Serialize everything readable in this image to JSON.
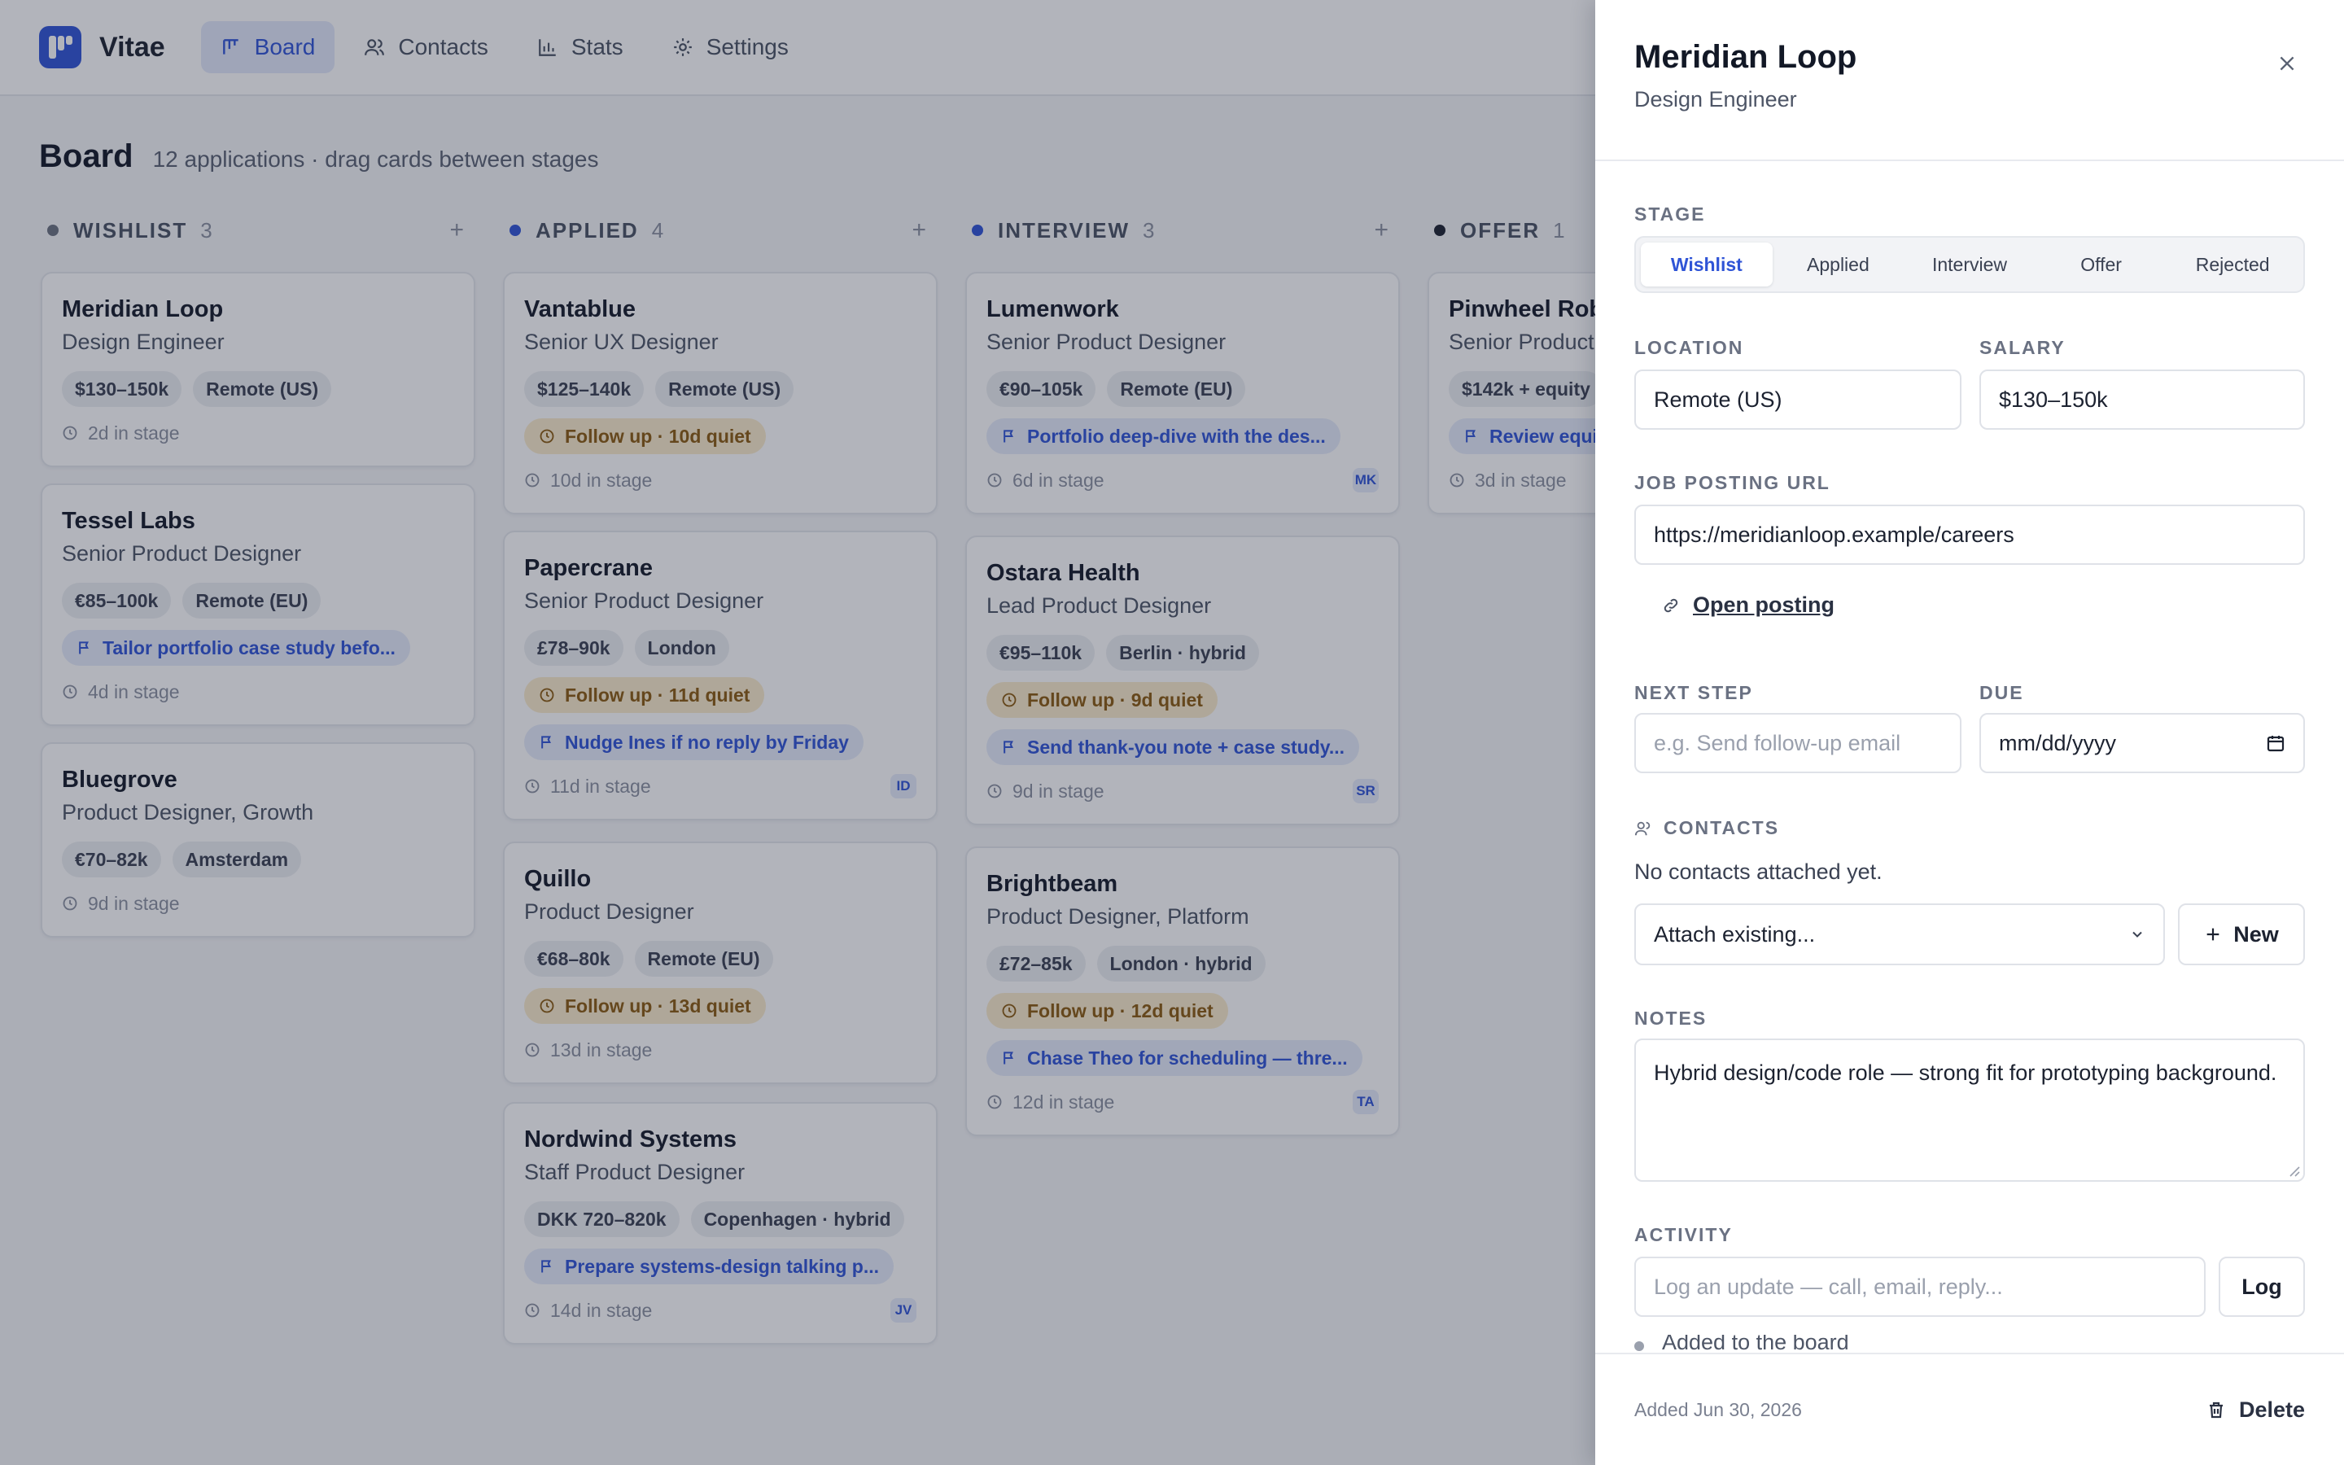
{
  "app": {
    "name": "Vitae"
  },
  "nav": [
    {
      "label": "Board",
      "icon": "board-icon",
      "active": true
    },
    {
      "label": "Contacts",
      "icon": "people-icon",
      "active": false
    },
    {
      "label": "Stats",
      "icon": "bar-chart-icon",
      "active": false
    },
    {
      "label": "Settings",
      "icon": "gear-icon",
      "active": false
    }
  ],
  "board": {
    "title": "Board",
    "subtitle": "12 applications · drag cards between stages"
  },
  "columns": [
    {
      "name": "WISHLIST",
      "count": "3",
      "color": "#6b7280",
      "add": "+",
      "cards": [
        {
          "company": "Meridian Loop",
          "role": "Design Engineer",
          "chips": [
            "$130–150k",
            "Remote (US)"
          ],
          "days": "2d in stage"
        },
        {
          "company": "Tessel Labs",
          "role": "Senior Product Designer",
          "chips": [
            "€85–100k",
            "Remote (EU)"
          ],
          "next": "Tailor portfolio case study befo...",
          "days": "4d in stage"
        },
        {
          "company": "Bluegrove",
          "role": "Product Designer, Growth",
          "chips": [
            "€70–82k",
            "Amsterdam"
          ],
          "days": "9d in stage"
        }
      ]
    },
    {
      "name": "APPLIED",
      "count": "4",
      "color": "#2f54d6",
      "add": "+",
      "cards": [
        {
          "company": "Vantablue",
          "role": "Senior UX Designer",
          "chips": [
            "$125–140k",
            "Remote (US)"
          ],
          "follow": "Follow up · 10d quiet",
          "days": "10d in stage"
        },
        {
          "company": "Papercrane",
          "role": "Senior Product Designer",
          "chips": [
            "£78–90k",
            "London"
          ],
          "follow": "Follow up · 11d quiet",
          "next": "Nudge Ines if no reply by Friday",
          "days": "11d in stage",
          "initials": "ID"
        },
        {
          "company": "Quillo",
          "role": "Product Designer",
          "chips": [
            "€68–80k",
            "Remote (EU)"
          ],
          "follow": "Follow up · 13d quiet",
          "days": "13d in stage"
        },
        {
          "company": "Nordwind Systems",
          "role": "Staff Product Designer",
          "chips": [
            "DKK 720–820k",
            "Copenhagen · hybrid"
          ],
          "next": "Prepare systems-design talking p...",
          "days": "14d in stage",
          "initials": "JV"
        }
      ]
    },
    {
      "name": "INTERVIEW",
      "count": "3",
      "color": "#2f54d6",
      "add": "+",
      "cards": [
        {
          "company": "Lumenwork",
          "role": "Senior Product Designer",
          "chips": [
            "€90–105k",
            "Remote (EU)"
          ],
          "next": "Portfolio deep-dive with the des...",
          "days": "6d in stage",
          "initials": "MK"
        },
        {
          "company": "Ostara Health",
          "role": "Lead Product Designer",
          "chips": [
            "€95–110k",
            "Berlin · hybrid"
          ],
          "follow": "Follow up · 9d quiet",
          "next": "Send thank-you note + case study...",
          "days": "9d in stage",
          "initials": "SR"
        },
        {
          "company": "Brightbeam",
          "role": "Product Designer, Platform",
          "chips": [
            "£72–85k",
            "London · hybrid"
          ],
          "follow": "Follow up · 12d quiet",
          "next": "Chase Theo for scheduling — thre...",
          "days": "12d in stage",
          "initials": "TA"
        }
      ]
    },
    {
      "name": "OFFER",
      "count": "1",
      "color": "#1c2230",
      "add": "+",
      "cards": [
        {
          "company": "Pinwheel Robotics",
          "role": "Senior Product Designer",
          "chips": [
            "$142k + equity",
            ""
          ],
          "next": "Review equity terms",
          "days": "3d in stage"
        }
      ]
    }
  ],
  "panel": {
    "title": "Meridian Loop",
    "subtitle": "Design Engineer",
    "stage_label": "STAGE",
    "stages": [
      "Wishlist",
      "Applied",
      "Interview",
      "Offer",
      "Rejected"
    ],
    "active_stage": "Wishlist",
    "location_label": "LOCATION",
    "location_value": "Remote (US)",
    "salary_label": "SALARY",
    "salary_value": "$130–150k",
    "url_label": "JOB POSTING URL",
    "url_value": "https://meridianloop.example/careers",
    "open_posting": "Open posting",
    "next_step_label": "NEXT STEP",
    "next_step_placeholder": "e.g. Send follow-up email",
    "due_label": "DUE",
    "due_placeholder": "mm/dd/yyyy",
    "contacts_label": "CONTACTS",
    "no_contacts": "No contacts attached yet.",
    "attach_existing": "Attach existing...",
    "new_button": "New",
    "notes_label": "NOTES",
    "notes_value": "Hybrid design/code role — strong fit for prototyping background.",
    "activity_label": "ACTIVITY",
    "activity_placeholder": "Log an update — call, email, reply...",
    "log_button": "Log",
    "activity_item": "Added to the board",
    "added_date": "Added Jun 30, 2026",
    "delete_button": "Delete"
  }
}
